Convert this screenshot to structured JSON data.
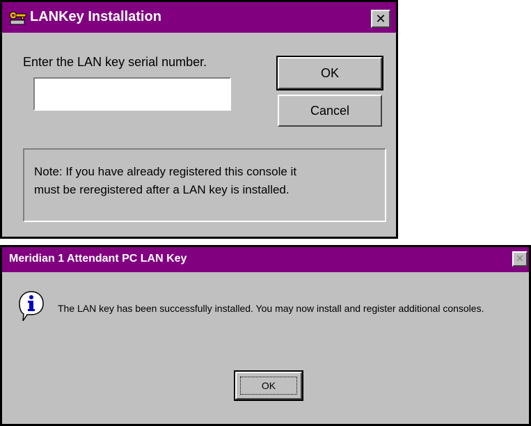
{
  "colors": {
    "titlebar": "#800080",
    "face": "#c0c0c0",
    "title_text": "#ffffff"
  },
  "dialog1": {
    "icon": "key-icon",
    "title": "LANKey Installation",
    "close_label": "✕",
    "prompt": "Enter the LAN key serial number.",
    "serial_value": "",
    "ok_label": "OK",
    "cancel_label": "Cancel",
    "note_line1": "Note: If you have already registered this console it",
    "note_line2": "must be reregistered after a LAN key is installed."
  },
  "dialog2": {
    "title": "Meridian 1 Attendant PC LAN Key",
    "close_label": "✕",
    "icon": "info-icon",
    "message": "The LAN key has been successfully installed. You may now install and register additional consoles.",
    "ok_label": "OK"
  }
}
